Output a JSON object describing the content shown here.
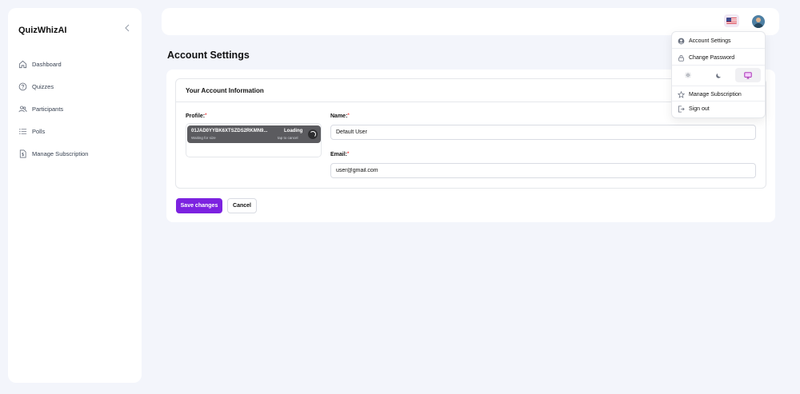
{
  "app": {
    "brand": "QuizWhizAI"
  },
  "sidebar": {
    "items": [
      {
        "label": "Dashboard",
        "icon": "home-icon"
      },
      {
        "label": "Quizzes",
        "icon": "help-circle-icon"
      },
      {
        "label": "Participants",
        "icon": "users-icon"
      },
      {
        "label": "Polls",
        "icon": "list-icon"
      },
      {
        "label": "Manage Subscription",
        "icon": "dollar-file-icon"
      }
    ]
  },
  "page": {
    "title": "Account Settings"
  },
  "form": {
    "section_title": "Your Account Information",
    "profile_label": "Profile:",
    "required_mark": "*",
    "upload": {
      "file_name": "01JAD0YYBK6XTSZDS2RKMN9...",
      "file_status": "Waiting for size",
      "loading": "Loading",
      "tap_hint": "tap to cancel"
    },
    "name_label": "Name:",
    "name_value": "Default User",
    "email_label": "Email:",
    "email_value": "user@gmail.com",
    "save_label": "Save changes",
    "cancel_label": "Cancel"
  },
  "menu": {
    "account_settings": "Account Settings",
    "change_password": "Change Password",
    "manage_subscription": "Manage Subscription",
    "sign_out": "Sign out",
    "theme_selected": "system"
  },
  "colors": {
    "accent": "#7c22e0",
    "background": "#f3f5fb"
  }
}
